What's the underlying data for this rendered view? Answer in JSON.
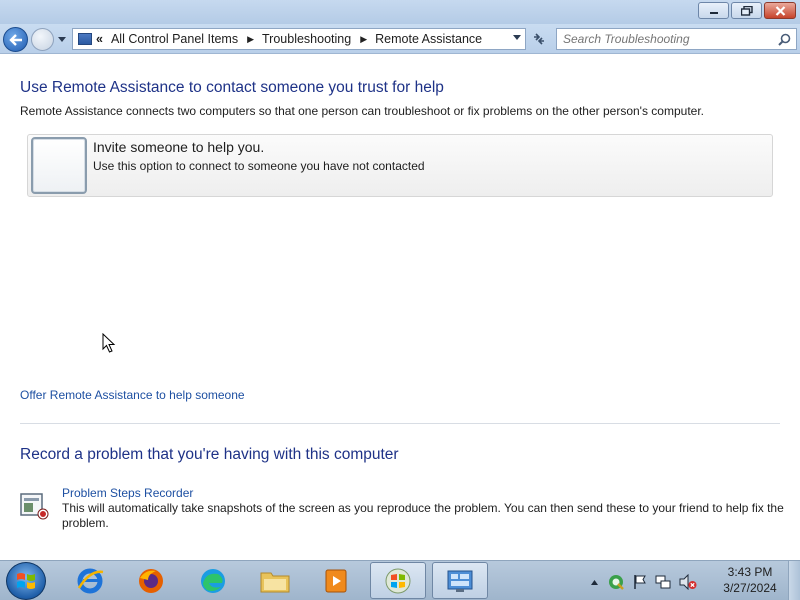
{
  "window": {
    "title_buttons": [
      "minimize",
      "maximize",
      "close"
    ]
  },
  "nav": {
    "overflow_chevron": "«",
    "breadcrumbs": [
      "All Control Panel Items",
      "Troubleshooting",
      "Remote Assistance"
    ],
    "separator": "▶",
    "search_placeholder": "Search Troubleshooting"
  },
  "content": {
    "heading": "Use Remote Assistance to contact someone you trust for help",
    "description": "Remote Assistance connects two computers so that one person can troubleshoot or fix problems on the other person's computer.",
    "invite": {
      "title": "Invite someone to help you.",
      "subtitle": "Use this option to connect to someone you have not contacted"
    },
    "offer_link": "Offer Remote Assistance to help someone",
    "record_heading": "Record a problem that you're having with this computer",
    "psr": {
      "link": "Problem Steps Recorder",
      "description": "This will automatically take snapshots of the screen as you reproduce the problem. You can then send these to your friend to help fix the problem."
    }
  },
  "taskbar": {
    "pinned": [
      "internet-explorer-icon",
      "firefox-icon",
      "edge-icon",
      "file-explorer-icon",
      "media-player-icon",
      "windows-app-icon",
      "control-panel-icon"
    ],
    "tray": [
      "show-hidden-icons",
      "network-update-icon",
      "action-center-flag-icon",
      "network-icon",
      "volume-muted-icon"
    ],
    "time": "3:43 PM",
    "date": "3/27/2024"
  },
  "colors": {
    "heading": "#1e3287",
    "link": "#1e50a2",
    "titlebar": "#c6d9ef",
    "taskbar": "#a9bdd2"
  }
}
